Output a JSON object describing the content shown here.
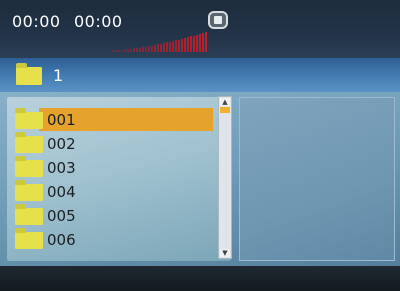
{
  "status": {
    "elapsed_time": "00:00",
    "total_time": "00:00",
    "playback_icon": "stop-icon",
    "level_meter_icon": "audio-level-meter-icon"
  },
  "path": {
    "icon": "folder-icon",
    "label": "1"
  },
  "file_list": {
    "selected_index": 0,
    "items": [
      {
        "icon": "folder-icon",
        "label": "001"
      },
      {
        "icon": "folder-icon",
        "label": "002"
      },
      {
        "icon": "folder-icon",
        "label": "003"
      },
      {
        "icon": "folder-icon",
        "label": "004"
      },
      {
        "icon": "folder-icon",
        "label": "005"
      },
      {
        "icon": "folder-icon",
        "label": "006"
      }
    ]
  },
  "scrollbar": {
    "up_icon": "scroll-up-arrow-icon",
    "down_icon": "scroll-down-arrow-icon"
  },
  "colors": {
    "highlight": "#e5a32d",
    "folder": "#e6e04a",
    "level_meter": "#c21d2a"
  }
}
